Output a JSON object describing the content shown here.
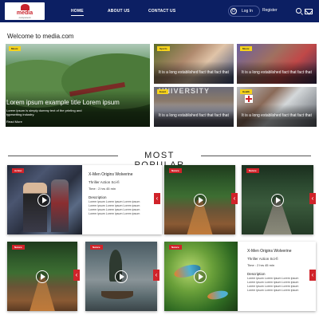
{
  "header": {
    "logo": {
      "word": "media",
      "tagline": "component"
    },
    "nav": [
      "HOME",
      "ABOUT US",
      "CONTACT US"
    ],
    "login_label": "Log In",
    "register_label": "Register"
  },
  "welcome": "Welcome to media.com",
  "hero": {
    "badge": "Music",
    "title": "Lorem ipsum example title Lorem ipsum",
    "description": "Lorem ipsum is simply dummy text of the printing and typesetting industry.",
    "more": "Read More"
  },
  "cards": [
    {
      "badge": "Sports",
      "text": "It is a long established fact that fact that"
    },
    {
      "badge": "Music",
      "text": "It is a long established fact that fact that"
    },
    {
      "badge": "Event",
      "overlay": "UNIVERSITY",
      "text": "It is a long established fact that fact that"
    },
    {
      "badge": "Health",
      "text": "It is a long established fact that fact that"
    }
  ],
  "popular": {
    "title": "MOST POPULAR",
    "badge": "Action",
    "badge_nature": "Nature",
    "featured1": {
      "title": "X-Men Origins Wolverine",
      "genre": "Thriller Action Sci-fi",
      "time": "Time :  2 hrs 45 min",
      "desc_label": "Description",
      "desc": "Lorem ipsum Lorem ipsum Lorem ipsum Lorem ipsum Lorem ipsum Lorem ipsum Lorem ipsum Lorem ipsum Lorem ipsum Lorem ipsum Lorem ipsum Lorem ipsum"
    },
    "featured2": {
      "title": "X-Men Origins Wolverine",
      "genre": "Thriller Action Sci-fi",
      "time": "Time :  2 hrs 45 min",
      "desc_label": "Description",
      "desc": "Lorem ipsum Lorem ipsum Lorem ipsum Lorem ipsum Lorem ipsum Lorem ipsum Lorem ipsum Lorem ipsum Lorem ipsum Lorem ipsum Lorem ipsum Lorem ipsum"
    },
    "arrow": "‹"
  }
}
